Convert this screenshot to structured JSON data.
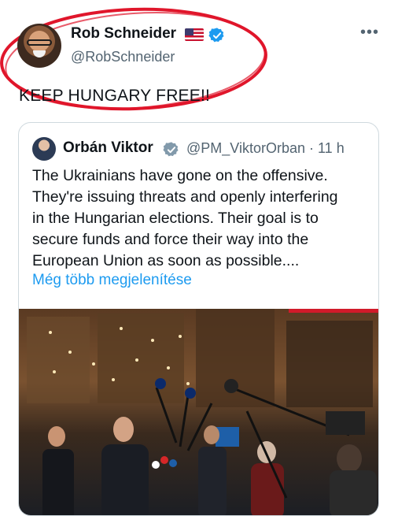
{
  "tweet": {
    "author_name": "Rob Schneider",
    "author_handle": "@RobSchneider",
    "text": "KEEP HUNGARY FREE!!",
    "more_icon": "•••",
    "icons": [
      "us-flag-icon",
      "verified-badge-icon",
      "more-icon"
    ]
  },
  "quoted_tweet": {
    "author_name": "Orbán Viktor",
    "author_handle": "@PM_ViktorOrban",
    "time": "· 11 h",
    "text_lines": [
      "The Ukrainians have gone on the offensive.",
      "They're issuing threats and openly interfering",
      "in the Hungarian elections. Their goal is to",
      "secure funds and force their way into the",
      "European Union as soon as possible...."
    ],
    "show_more": "Még több megjelenítése",
    "icons": [
      "verified-badge-gray-icon"
    ]
  },
  "colors": {
    "link": "#1d9bf0",
    "verified_blue": "#1d9bf0",
    "verified_gray": "#829aab",
    "annotation_red": "#e0162b",
    "muted_text": "#536471"
  }
}
